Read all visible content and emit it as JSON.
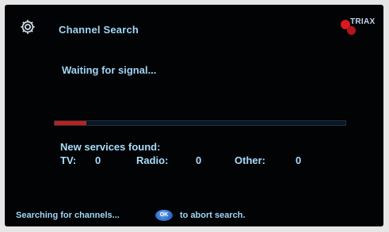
{
  "header": {
    "title": "Channel Search",
    "settings_icon": "gear-icon",
    "brand": "TRIAX",
    "brand_color": "#d71920"
  },
  "status": {
    "text": "Waiting for signal...",
    "progress_percent": 11,
    "progress_color": "#c21f1a"
  },
  "results": {
    "heading": "New services found:",
    "tv_label": "TV:",
    "tv_count": "0",
    "radio_label": "Radio:",
    "radio_count": "0",
    "other_label": "Other:",
    "other_count": "0"
  },
  "footer": {
    "searching_text": "Searching for channels...",
    "ok_button_label": "OK",
    "abort_text": "to abort search."
  }
}
